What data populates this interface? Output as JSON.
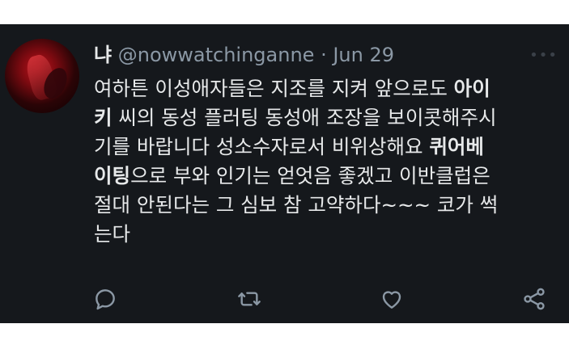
{
  "tweet": {
    "display_name": "냐",
    "handle": "@nowwatchinganne",
    "separator": "·",
    "date": "Jun 29",
    "more_icon": "more-dots-icon",
    "text_segments": [
      {
        "text": "여하튼 이성애자들은 지조를 지켜 앞으로도 ",
        "bold": false
      },
      {
        "text": "아이키",
        "bold": true
      },
      {
        "text": " 씨의 동성 플러팅 동성애 조장을 보이콧해주시기를 바랍니다 성소수자로서 비위상해요 ",
        "bold": false
      },
      {
        "text": "퀴어베이팅",
        "bold": true
      },
      {
        "text": "으로 부와 인기는 얻엇음 좋겠고 이반클럽은 절대 안된다는 그 심보 참 고약하다~~~ 코가 썩는다",
        "bold": false
      }
    ],
    "lines": [
      [
        {
          "t": "여하튼 이성애자들은 지조를 지켜 앞으로도 ",
          "b": false
        },
        {
          "t": "아이",
          "b": true
        }
      ],
      [
        {
          "t": "키",
          "b": true
        },
        {
          "t": " 씨의 동성 플러팅 동성애 조장을 보이콧해주시",
          "b": false
        }
      ],
      [
        {
          "t": "기를 바랍니다 성소수자로서 비위상해요 ",
          "b": false
        },
        {
          "t": "퀴어베",
          "b": true
        }
      ],
      [
        {
          "t": "이팅",
          "b": true
        },
        {
          "t": "으로 부와 인기는 얻엇음 좋겠고 이반클럽은",
          "b": false
        }
      ],
      [
        {
          "t": "절대 안된다는 그 심보 참 고약하다~~~ 코가 썩",
          "b": false
        }
      ],
      [
        {
          "t": "는다",
          "b": false
        }
      ]
    ]
  },
  "actions": [
    {
      "name": "reply-icon"
    },
    {
      "name": "retweet-icon"
    },
    {
      "name": "like-icon"
    },
    {
      "name": "share-icon"
    }
  ],
  "colors": {
    "background": "#15181c",
    "text": "#e7e9ea",
    "secondary": "#8b98a5",
    "icon": "#8b98a5"
  }
}
